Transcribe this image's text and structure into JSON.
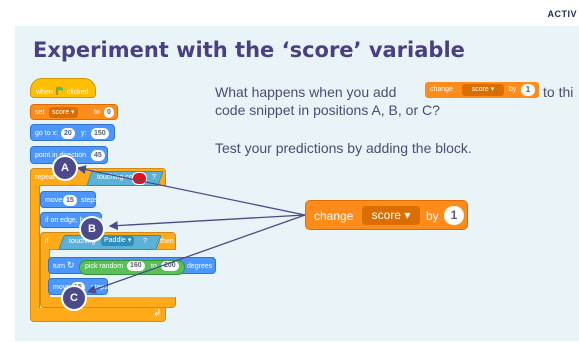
{
  "header": {
    "tag": "ACTIV"
  },
  "slide": {
    "title": "Experiment with the ‘score’ variable",
    "question_line1_a": "What happens when you add",
    "question_line1_b": "to thi",
    "question_line2": "code snippet in positions A, B, or C?",
    "instruction": "Test your predictions by adding the block."
  },
  "inline_block": {
    "change": "change",
    "variable": "score ▾",
    "by": "by",
    "value": "1"
  },
  "big_block": {
    "change": "change",
    "variable": "score ▾",
    "by": "by",
    "value": "1"
  },
  "script": {
    "hat": {
      "label": "when",
      "flag_icon": "green-flag-icon",
      "clicked": "clicked"
    },
    "set": {
      "label": "set",
      "variable": "score ▾",
      "to": "to",
      "value": "0"
    },
    "goto": {
      "label": "go to x:",
      "x": "20",
      "y_label": "y:",
      "y": "150"
    },
    "point": {
      "label": "point in direction",
      "value": "45"
    },
    "repeat": {
      "label": "repeat until",
      "sensing": "touching color",
      "qmark": "?"
    },
    "move1": {
      "label": "move",
      "value": "15",
      "steps": "steps"
    },
    "bounce": {
      "label": "if on edge, bounce"
    },
    "if_block": {
      "label": "if",
      "sensing": "touching",
      "target": "Paddle ▾",
      "qmark": "?",
      "then": "then"
    },
    "turn": {
      "label": "turn",
      "op": "pick random",
      "from": "160",
      "to_label": "to",
      "to": "200",
      "degrees": "degrees"
    },
    "move2": {
      "label": "move",
      "value": "15",
      "steps": "steps"
    },
    "loop_arrow": "↲"
  },
  "markers": {
    "a": "A",
    "b": "B",
    "c": "C"
  },
  "colors": {
    "events": "#ffbf00",
    "variables": "#ff8c1a",
    "motion": "#4c97ff",
    "control": "#ffab19",
    "sensing": "#5cb1d6",
    "operators": "#59c059",
    "title": "#4b3f83",
    "marker": "#4b4a8a",
    "touch_color": "#e0141e"
  }
}
